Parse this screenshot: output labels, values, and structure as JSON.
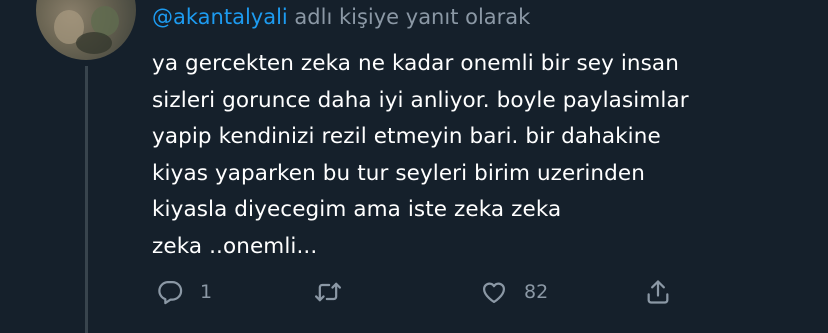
{
  "reply_context": {
    "handle": "@akantalyali",
    "suffix": " adlı kişiye yanıt olarak"
  },
  "tweet": {
    "text": "ya gercekten zeka ne kadar onemli bir sey insan\nsizleri gorunce daha iyi anliyor. boyle paylasimlar\nyapip kendinizi rezil etmeyin bari. bir dahakine\nkiyas yaparken bu tur seyleri birim uzerinden\nkiyasla diyecegim ama iste zeka zeka\nzeka ..onemli..."
  },
  "actions": {
    "reply": {
      "icon": "reply-icon",
      "count": "1"
    },
    "retweet": {
      "icon": "retweet-icon",
      "count": ""
    },
    "like": {
      "icon": "heart-icon",
      "count": "82"
    },
    "share": {
      "icon": "share-icon",
      "count": ""
    }
  },
  "colors": {
    "background": "#15202b",
    "text": "#ffffff",
    "secondary": "#8b98a5",
    "accent": "#1d9bf0",
    "thread_line": "#38444d"
  }
}
